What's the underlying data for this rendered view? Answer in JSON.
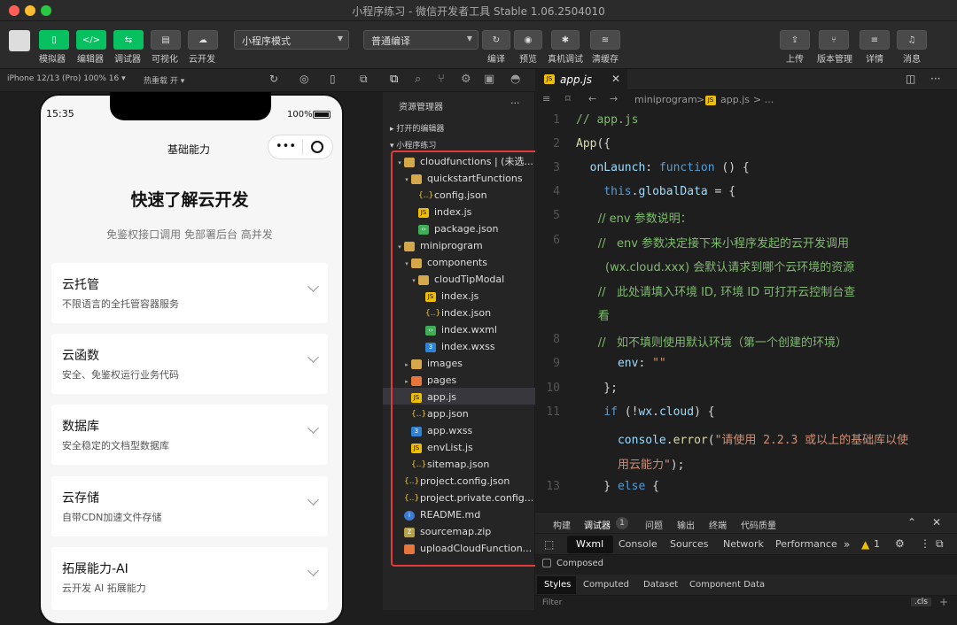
{
  "window": {
    "title": "小程序练习 - 微信开发者工具 Stable 1.06.2504010"
  },
  "toolbar": {
    "left_labels": [
      "模拟器",
      "编辑器",
      "调试器",
      "可视化",
      "云开发"
    ],
    "mode": "小程序模式",
    "compile": "普通编译",
    "mid_labels": [
      "编译",
      "预览",
      "真机调试",
      "清缓存"
    ],
    "right_labels": [
      "上传",
      "版本管理",
      "详情",
      "消息"
    ]
  },
  "simulator": {
    "device": "iPhone 12/13 (Pro) 100% 16 ▾",
    "hot_reload": "热重载 开 ▾",
    "status_time": "15:35",
    "battery": "100%",
    "nav_title": "基础能力",
    "capsule_dots": "•••",
    "headline": "快速了解云开发",
    "subline": "免鉴权接口调用 免部署后台 高并发",
    "cards": [
      {
        "title": "云托管",
        "sub": "不限语言的全托管容器服务"
      },
      {
        "title": "云函数",
        "sub": "安全、免鉴权运行业务代码"
      },
      {
        "title": "数据库",
        "sub": "安全稳定的文档型数据库"
      },
      {
        "title": "云存储",
        "sub": "自带CDN加速文件存储"
      },
      {
        "title": "拓展能力-AI",
        "sub": "云开发 AI 拓展能力"
      }
    ]
  },
  "explorer": {
    "title": "资源管理器",
    "more": "···",
    "open_editors": "打开的编辑器",
    "project": "小程序练习",
    "tree": [
      {
        "name": "cloudfunctions | (未选...",
        "depth": 1,
        "icon": "fold",
        "arrow": "▾"
      },
      {
        "name": "quickstartFunctions",
        "depth": 2,
        "icon": "fold",
        "arrow": "▾"
      },
      {
        "name": "config.json",
        "depth": 3,
        "icon": "json",
        "arrow": ""
      },
      {
        "name": "index.js",
        "depth": 3,
        "icon": "js",
        "arrow": ""
      },
      {
        "name": "package.json",
        "depth": 3,
        "icon": "wxml",
        "arrow": ""
      },
      {
        "name": "miniprogram",
        "depth": 1,
        "icon": "fold",
        "arrow": "▾"
      },
      {
        "name": "components",
        "depth": 2,
        "icon": "fold",
        "arrow": "▾"
      },
      {
        "name": "cloudTipModal",
        "depth": 3,
        "icon": "fold",
        "arrow": "▾"
      },
      {
        "name": "index.js",
        "depth": 4,
        "icon": "js",
        "arrow": ""
      },
      {
        "name": "index.json",
        "depth": 4,
        "icon": "json",
        "arrow": ""
      },
      {
        "name": "index.wxml",
        "depth": 4,
        "icon": "wxml",
        "arrow": ""
      },
      {
        "name": "index.wxss",
        "depth": 4,
        "icon": "wxss",
        "arrow": ""
      },
      {
        "name": "images",
        "depth": 2,
        "icon": "fold",
        "arrow": "▸"
      },
      {
        "name": "pages",
        "depth": 2,
        "icon": "orange",
        "arrow": "▸"
      },
      {
        "name": "app.js",
        "depth": 2,
        "icon": "js",
        "arrow": ""
      },
      {
        "name": "app.json",
        "depth": 2,
        "icon": "json",
        "arrow": ""
      },
      {
        "name": "app.wxss",
        "depth": 2,
        "icon": "wxss",
        "arrow": ""
      },
      {
        "name": "envList.js",
        "depth": 2,
        "icon": "js",
        "arrow": ""
      },
      {
        "name": "sitemap.json",
        "depth": 2,
        "icon": "json",
        "arrow": ""
      },
      {
        "name": "project.config.json",
        "depth": 1,
        "icon": "json",
        "arrow": ""
      },
      {
        "name": "project.private.config...",
        "depth": 1,
        "icon": "json",
        "arrow": ""
      },
      {
        "name": "README.md",
        "depth": 1,
        "icon": "md",
        "arrow": ""
      },
      {
        "name": "sourcemap.zip",
        "depth": 1,
        "icon": "zip",
        "arrow": ""
      },
      {
        "name": "uploadCloudFunction...",
        "depth": 1,
        "icon": "orange",
        "arrow": ""
      }
    ]
  },
  "editor": {
    "tab": "app.js",
    "breadcrumb_dir": "miniprogram",
    "breadcrumb_sep": ">",
    "breadcrumb_file": "app.js",
    "breadcrumb_more": "> ..."
  },
  "panel": {
    "tabs": [
      "构建",
      "调试器",
      "问题",
      "输出",
      "终端",
      "代码质量"
    ],
    "badge": "1",
    "devtabs": [
      "Wxml",
      "Console",
      "Sources",
      "Network",
      "Performance"
    ],
    "warn_count": "1",
    "composed": "Composed",
    "subtabs": [
      "Styles",
      "Computed",
      "Dataset",
      "Component Data"
    ],
    "filter": "Filter",
    "cls": ".cls"
  },
  "colors": {
    "accent_green": "#07c160",
    "highlight_red": "#e53a3a"
  }
}
